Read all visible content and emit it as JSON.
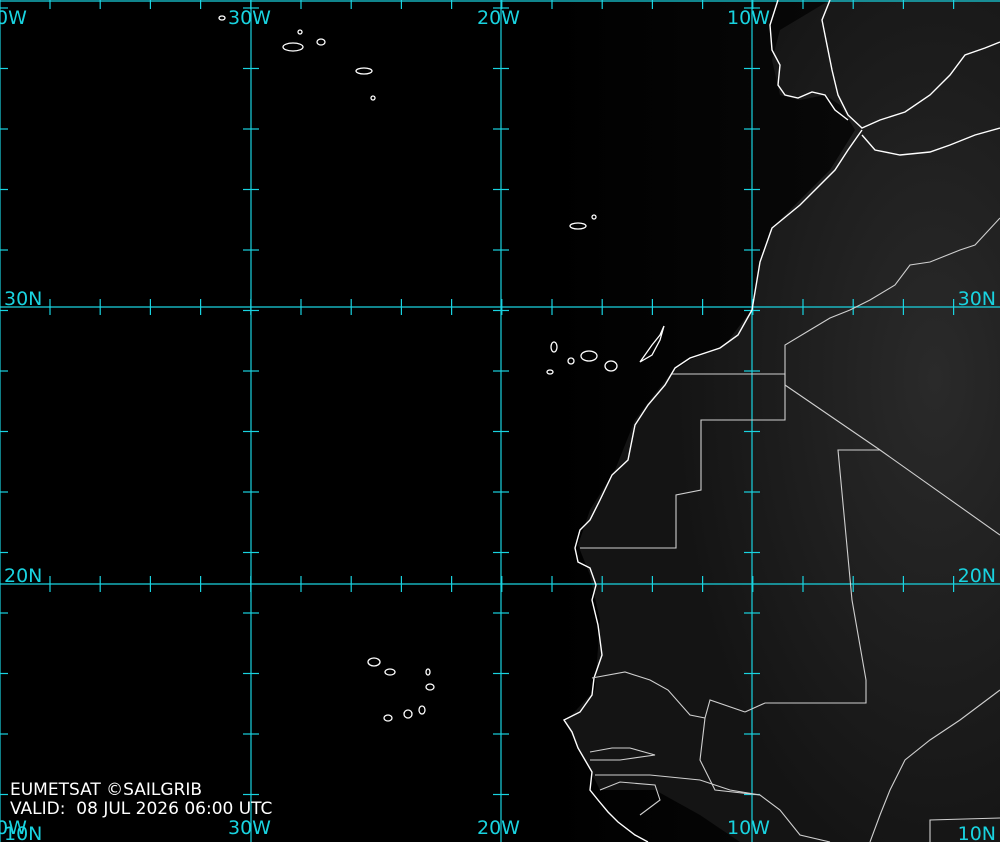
{
  "source": "EUMETSAT ©SAILGRIB",
  "valid_prefix": "VALID:",
  "valid_time": "08 JUL 2026 06:00 UTC",
  "colors": {
    "background": "#000000",
    "land_tint": "#1f1f1f",
    "grid": "#19d3e0",
    "coast": "#ffffff",
    "border": "#d0d0d0"
  },
  "longitude_labels": [
    {
      "id": "40w",
      "text": "0W"
    },
    {
      "id": "30w",
      "text": "30W"
    },
    {
      "id": "20w",
      "text": "20W"
    },
    {
      "id": "10w",
      "text": "10W"
    }
  ],
  "longitude_labels_bottom": [
    {
      "id": "40w",
      "text": "0W"
    },
    {
      "id": "30w",
      "text": "30W"
    },
    {
      "id": "20w",
      "text": "20W"
    },
    {
      "id": "10w",
      "text": "10W"
    }
  ],
  "latitude_labels": [
    {
      "id": "30n",
      "text": "30N"
    },
    {
      "id": "20n",
      "text": "20N"
    },
    {
      "id": "10n",
      "text": "10N"
    }
  ],
  "latitude_labels_right": [
    {
      "id": "30n",
      "text": "30N"
    },
    {
      "id": "20n",
      "text": "20N"
    },
    {
      "id": "10n",
      "text": "10N"
    }
  ]
}
